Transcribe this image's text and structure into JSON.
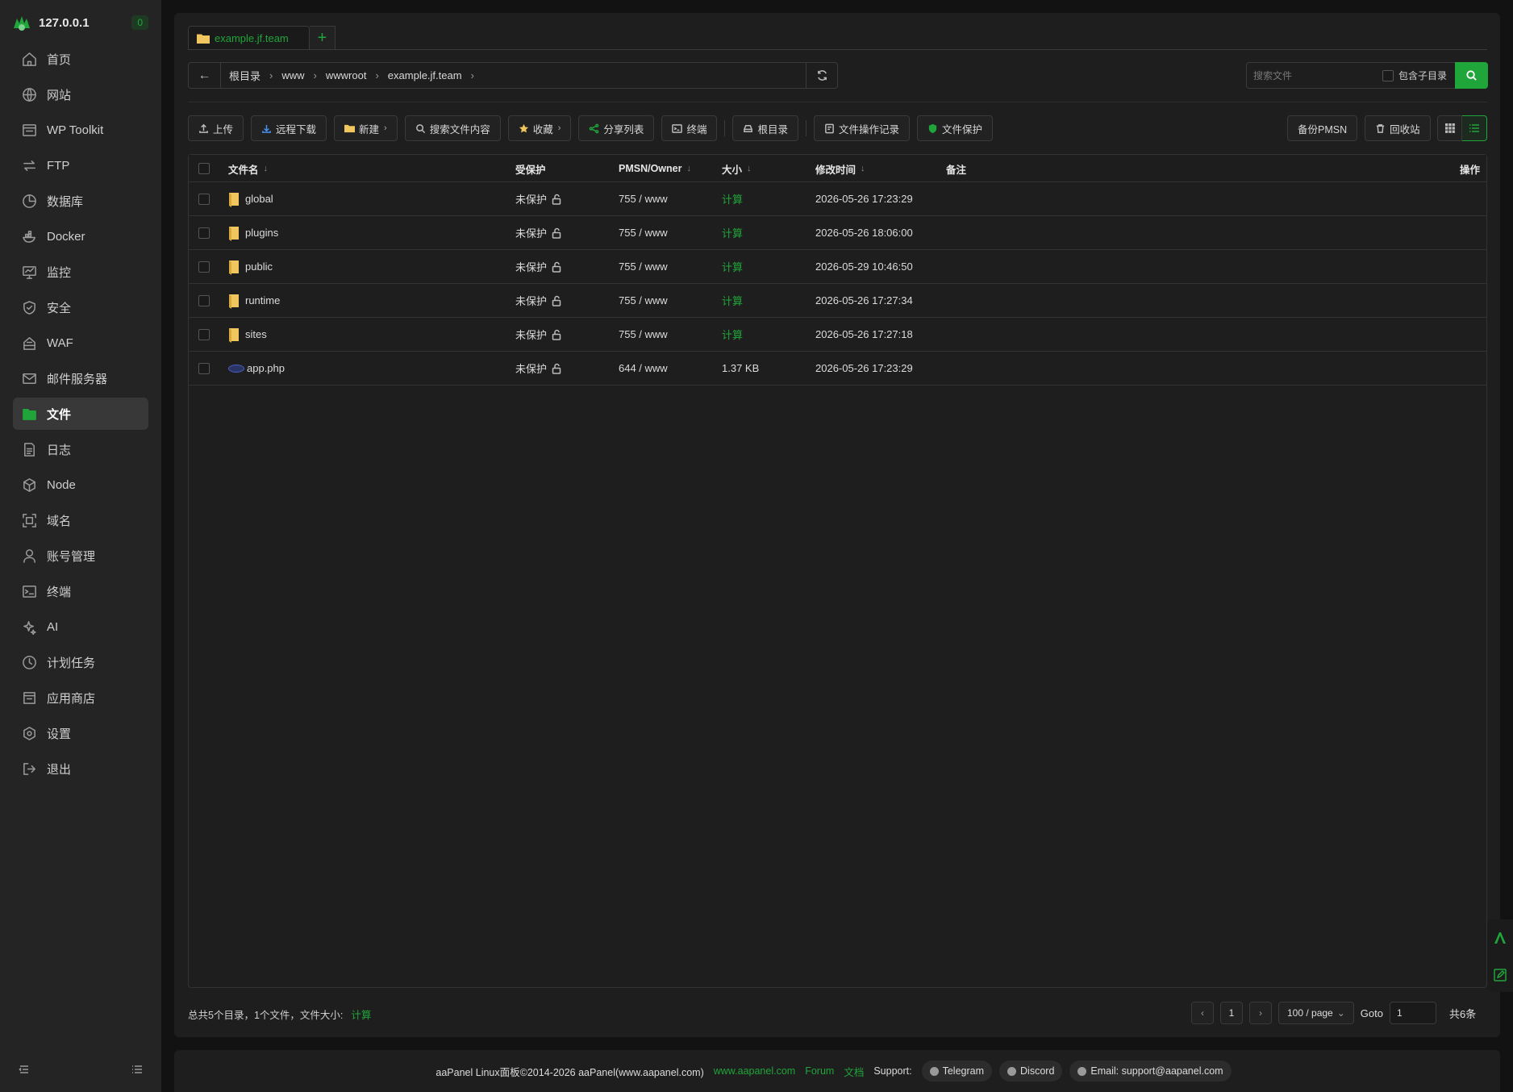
{
  "sidebar": {
    "host": "127.0.0.1",
    "badge": "0",
    "items": [
      {
        "label": "首页",
        "icon": "home-icon"
      },
      {
        "label": "网站",
        "icon": "globe-icon"
      },
      {
        "label": "WP Toolkit",
        "icon": "wp-icon"
      },
      {
        "label": "FTP",
        "icon": "ftp-icon"
      },
      {
        "label": "数据库",
        "icon": "database-icon"
      },
      {
        "label": "Docker",
        "icon": "docker-icon"
      },
      {
        "label": "监控",
        "icon": "monitor-icon"
      },
      {
        "label": "安全",
        "icon": "shield-icon"
      },
      {
        "label": "WAF",
        "icon": "waf-icon"
      },
      {
        "label": "邮件服务器",
        "icon": "mail-icon"
      },
      {
        "label": "文件",
        "icon": "folder-icon"
      },
      {
        "label": "日志",
        "icon": "log-icon"
      },
      {
        "label": "Node",
        "icon": "node-icon"
      },
      {
        "label": "域名",
        "icon": "domain-icon"
      },
      {
        "label": "账号管理",
        "icon": "user-icon"
      },
      {
        "label": "终端",
        "icon": "terminal-icon"
      },
      {
        "label": "AI",
        "icon": "ai-icon"
      },
      {
        "label": "计划任务",
        "icon": "clock-icon"
      },
      {
        "label": "应用商店",
        "icon": "store-icon"
      },
      {
        "label": "设置",
        "icon": "settings-icon"
      },
      {
        "label": "退出",
        "icon": "logout-icon"
      }
    ],
    "active_index": 10
  },
  "tabs": [
    {
      "label": "example.jf.team"
    }
  ],
  "breadcrumb": [
    "根目录",
    "www",
    "wwwroot",
    "example.jf.team"
  ],
  "search": {
    "placeholder": "搜索文件",
    "subdir_label": "包含子目录"
  },
  "toolbar": {
    "upload": "上传",
    "remote_download": "远程下载",
    "new": "新建",
    "search_content": "搜索文件内容",
    "favorites": "收藏",
    "share_list": "分享列表",
    "terminal": "终端",
    "root_dir": "根目录",
    "op_log": "文件操作记录",
    "file_protect": "文件保护",
    "backup_pmsn": "备份PMSN",
    "recycle_bin": "回收站"
  },
  "table": {
    "headers": {
      "name": "文件名",
      "protected": "受保护",
      "perm": "PMSN/Owner",
      "size": "大小",
      "mtime": "修改时间",
      "note": "备注",
      "ops": "操作"
    },
    "rows": [
      {
        "name": "global",
        "type": "folder",
        "protected": "未保护",
        "perm": "755 / www",
        "size": "计算",
        "mtime": "2026-05-26 17:23:29"
      },
      {
        "name": "plugins",
        "type": "folder",
        "protected": "未保护",
        "perm": "755 / www",
        "size": "计算",
        "mtime": "2026-05-26 18:06:00"
      },
      {
        "name": "public",
        "type": "folder",
        "protected": "未保护",
        "perm": "755 / www",
        "size": "计算",
        "mtime": "2026-05-29 10:46:50"
      },
      {
        "name": "runtime",
        "type": "folder",
        "protected": "未保护",
        "perm": "755 / www",
        "size": "计算",
        "mtime": "2026-05-26 17:27:34"
      },
      {
        "name": "sites",
        "type": "folder",
        "protected": "未保护",
        "perm": "755 / www",
        "size": "计算",
        "mtime": "2026-05-26 17:27:18"
      },
      {
        "name": "app.php",
        "type": "php",
        "protected": "未保护",
        "perm": "644 / www",
        "size": "1.37 KB",
        "mtime": "2026-05-26 17:23:29"
      }
    ]
  },
  "summary": {
    "text": "总共5个目录，1个文件，文件大小:",
    "calc": "计算"
  },
  "pager": {
    "current": "1",
    "per_page": "100 / page",
    "goto_label": "Goto",
    "goto_value": "1",
    "total": "共6条"
  },
  "footer": {
    "copyright": "aaPanel Linux面板©2014-2026 aaPanel(www.aapanel.com)",
    "site": "www.aapanel.com",
    "forum": "Forum",
    "docs": "文档",
    "support": "Support:",
    "telegram": "Telegram",
    "discord": "Discord",
    "email": "Email: support@aapanel.com"
  },
  "colors": {
    "accent": "#20a53a",
    "bg": "#121212",
    "panel": "#1e1e1e",
    "sidebar": "#242424"
  }
}
